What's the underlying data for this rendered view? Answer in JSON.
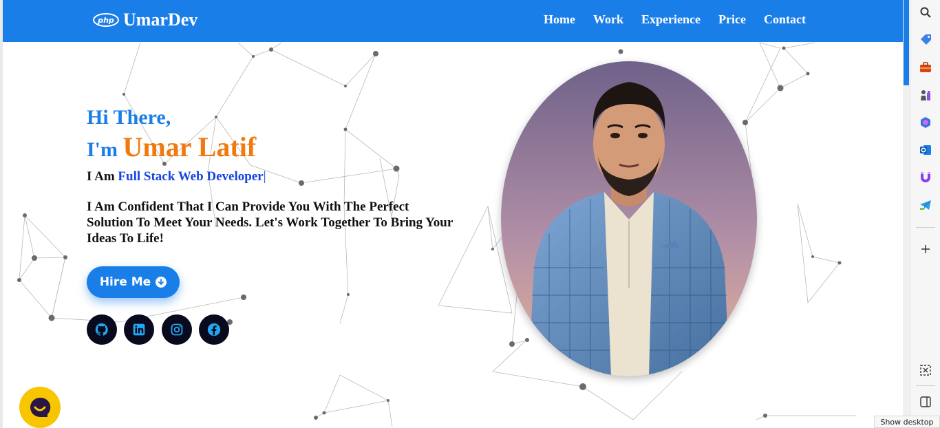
{
  "navbar": {
    "logo_badge": "php",
    "logo_text": "UmarDev",
    "links": [
      "Home",
      "Work",
      "Experience",
      "Price",
      "Contact"
    ]
  },
  "hero": {
    "greeting": "Hi There,",
    "intro_prefix": "I'm ",
    "name": "Umar Latif",
    "role_prefix": "I Am ",
    "role": "Full Stack Web Developer",
    "cursor": "|",
    "tagline": "I Am Confident That I Can Provide You With The Perfect Solution To Meet Your Needs. Let's Work Together To Bring Your Ideas To Life!",
    "hire_button": "Hire Me"
  },
  "social_icons": [
    "github-icon",
    "linkedin-icon",
    "instagram-icon",
    "facebook-icon"
  ],
  "sidebar_icons": [
    "search-icon",
    "tag-icon",
    "briefcase-icon",
    "chess-icon",
    "copilot-icon",
    "outlook-icon",
    "magnet-icon",
    "telegram-icon",
    "add-icon",
    "screenshot-icon",
    "sidebar-toggle-icon"
  ],
  "tooltip": "Show desktop",
  "colors": {
    "accent": "#1a7ee8",
    "name_orange": "#f07a10",
    "role_blue": "#1545e0",
    "chat_yellow": "#f7c600",
    "dark": "#0a0a1f"
  }
}
